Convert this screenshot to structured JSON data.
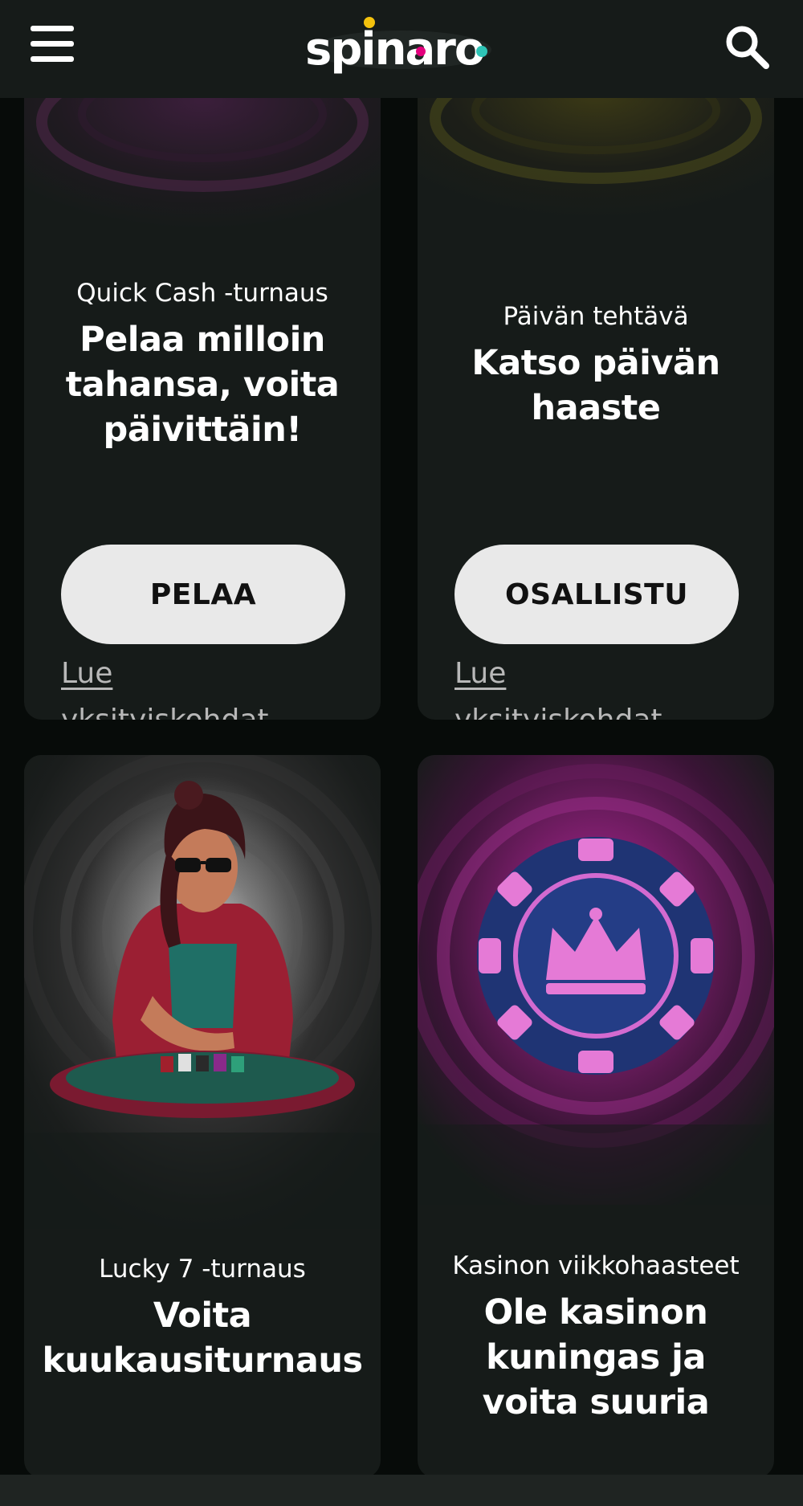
{
  "header": {
    "logo_text": "spinaro",
    "menu_icon": "hamburger-menu-icon",
    "search_icon": "search-icon",
    "background": "#161b19"
  },
  "cards": [
    {
      "subtitle": "Quick Cash -turnaus",
      "headline": "Pelaa milloin tahansa, voita päivittäin!",
      "button_label": "PELAA",
      "details_link": "Lue yksityiskohdat",
      "image_theme": "purple-swirl"
    },
    {
      "subtitle": "Päivän tehtävä",
      "headline": "Katso päivän haaste",
      "button_label": "OSALLISTU",
      "details_link": "Lue yksityiskohdat",
      "image_theme": "olive-swirl"
    },
    {
      "subtitle": "Lucky 7 -turnaus",
      "headline": "Voita kuukausiturnaus",
      "image_theme": "woman-at-poker-table"
    },
    {
      "subtitle": "Kasinon viikkohaasteet",
      "headline": "Ole kasinon kuningas ja voita suuria",
      "image_theme": "crown-poker-chip"
    }
  ],
  "colors": {
    "page_background": "#070b09",
    "card_background": "#161b19",
    "button_background": "#e9e9e9",
    "button_text": "#111111",
    "link_text": "#b8b8b8",
    "logo_dot_yellow": "#f4c20d",
    "logo_dot_magenta": "#e5007e",
    "logo_dot_teal": "#2ec4b6"
  }
}
